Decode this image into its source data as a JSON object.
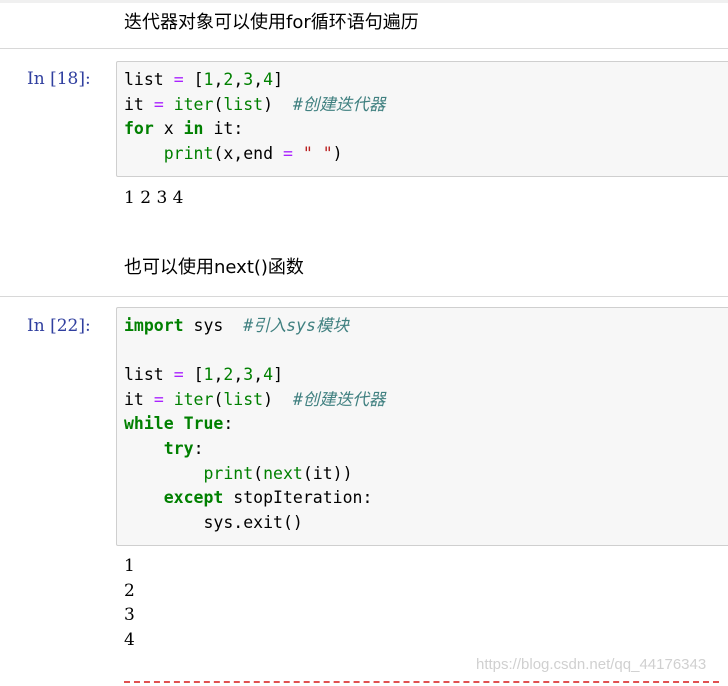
{
  "cells": [
    {
      "type": "markdown",
      "text": "迭代器对象可以使用for循环语句遍历"
    },
    {
      "type": "code",
      "prompt": "In [18]:",
      "lines": [
        [
          [
            "n",
            "list"
          ],
          [
            "p",
            " "
          ],
          [
            "op",
            "="
          ],
          [
            "p",
            " "
          ],
          [
            "p",
            "["
          ],
          [
            "num",
            "1"
          ],
          [
            "p",
            ","
          ],
          [
            "num",
            "2"
          ],
          [
            "p",
            ","
          ],
          [
            "num",
            "3"
          ],
          [
            "p",
            ","
          ],
          [
            "num",
            "4"
          ],
          [
            "p",
            "]"
          ]
        ],
        [
          [
            "n",
            "it"
          ],
          [
            "p",
            " "
          ],
          [
            "op",
            "="
          ],
          [
            "p",
            " "
          ],
          [
            "bi",
            "iter"
          ],
          [
            "p",
            "("
          ],
          [
            "bi",
            "list"
          ],
          [
            "p",
            ")"
          ],
          [
            "p",
            "  "
          ],
          [
            "cm",
            "#创建迭代器"
          ]
        ],
        [
          [
            "kw",
            "for"
          ],
          [
            "p",
            " "
          ],
          [
            "n",
            "x"
          ],
          [
            "p",
            " "
          ],
          [
            "kw",
            "in"
          ],
          [
            "p",
            " "
          ],
          [
            "n",
            "it"
          ],
          [
            "p",
            ":"
          ]
        ],
        [
          [
            "p",
            "    "
          ],
          [
            "bi",
            "print"
          ],
          [
            "p",
            "("
          ],
          [
            "n",
            "x"
          ],
          [
            "p",
            ","
          ],
          [
            "n",
            "end"
          ],
          [
            "p",
            " "
          ],
          [
            "op",
            "="
          ],
          [
            "p",
            " "
          ],
          [
            "str",
            "\" \""
          ],
          [
            "p",
            ")"
          ]
        ]
      ],
      "output": [
        "1 2 3 4"
      ]
    },
    {
      "type": "markdown",
      "text": "也可以使用next()函数"
    },
    {
      "type": "code",
      "prompt": "In [22]:",
      "lines": [
        [
          [
            "kw",
            "import"
          ],
          [
            "p",
            " "
          ],
          [
            "n",
            "sys"
          ],
          [
            "p",
            "  "
          ],
          [
            "cm",
            "#引入sys模块"
          ]
        ],
        [
          [
            "p",
            ""
          ]
        ],
        [
          [
            "n",
            "list"
          ],
          [
            "p",
            " "
          ],
          [
            "op",
            "="
          ],
          [
            "p",
            " "
          ],
          [
            "p",
            "["
          ],
          [
            "num",
            "1"
          ],
          [
            "p",
            ","
          ],
          [
            "num",
            "2"
          ],
          [
            "p",
            ","
          ],
          [
            "num",
            "3"
          ],
          [
            "p",
            ","
          ],
          [
            "num",
            "4"
          ],
          [
            "p",
            "]"
          ]
        ],
        [
          [
            "n",
            "it"
          ],
          [
            "p",
            " "
          ],
          [
            "op",
            "="
          ],
          [
            "p",
            " "
          ],
          [
            "bi",
            "iter"
          ],
          [
            "p",
            "("
          ],
          [
            "bi",
            "list"
          ],
          [
            "p",
            ")"
          ],
          [
            "p",
            "  "
          ],
          [
            "cm",
            "#创建迭代器"
          ]
        ],
        [
          [
            "kw",
            "while"
          ],
          [
            "p",
            " "
          ],
          [
            "kw",
            "True"
          ],
          [
            "p",
            ":"
          ]
        ],
        [
          [
            "p",
            "    "
          ],
          [
            "kw",
            "try"
          ],
          [
            "p",
            ":"
          ]
        ],
        [
          [
            "p",
            "        "
          ],
          [
            "bi",
            "print"
          ],
          [
            "p",
            "("
          ],
          [
            "bi",
            "next"
          ],
          [
            "p",
            "("
          ],
          [
            "n",
            "it"
          ],
          [
            "p",
            "))"
          ]
        ],
        [
          [
            "p",
            "    "
          ],
          [
            "kw",
            "except"
          ],
          [
            "p",
            " "
          ],
          [
            "n",
            "stopIteration"
          ],
          [
            "p",
            ":"
          ]
        ],
        [
          [
            "p",
            "        "
          ],
          [
            "n",
            "sys"
          ],
          [
            "p",
            "."
          ],
          [
            "n",
            "exit"
          ],
          [
            "p",
            "()"
          ]
        ]
      ],
      "output": [
        "1",
        "2",
        "3",
        "4"
      ]
    }
  ],
  "watermark": "https://blog.csdn.net/qq_44176343"
}
